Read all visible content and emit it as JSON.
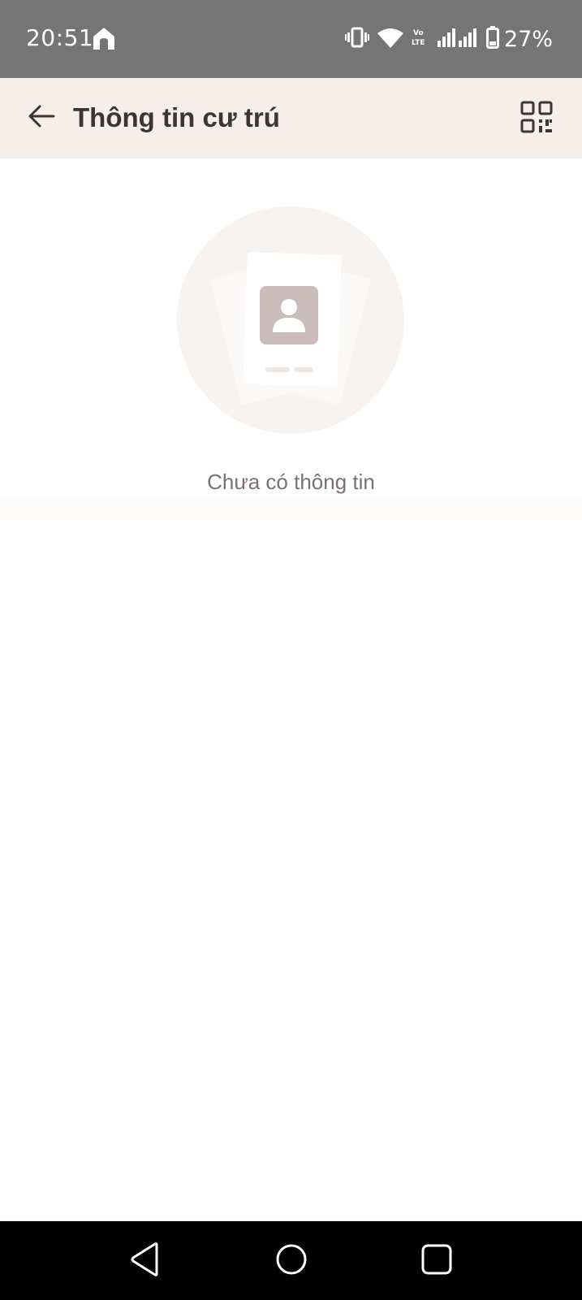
{
  "status_bar": {
    "time": "20:51",
    "battery_percent": "27%",
    "icons": [
      "home-icon",
      "vibrate-icon",
      "wifi-icon",
      "volte-icon",
      "signal-icon",
      "battery-icon"
    ]
  },
  "app_bar": {
    "title": "Thông tin cư trú",
    "back_icon": "arrow-left-icon",
    "qr_icon": "qr-code-icon"
  },
  "empty_state": {
    "message": "Chưa có thông tin",
    "illustration": "id-card-icon"
  },
  "nav_bar": {
    "icons": [
      "back-triangle-icon",
      "home-circle-icon",
      "recents-square-icon"
    ]
  },
  "colors": {
    "status_bar_bg": "#757575",
    "app_bar_bg": "#f4efeb",
    "title_text": "#3d3533",
    "empty_text": "#7a7270",
    "illustration_circle": "#f7f3f0",
    "avatar_box": "#c9bcbb"
  }
}
